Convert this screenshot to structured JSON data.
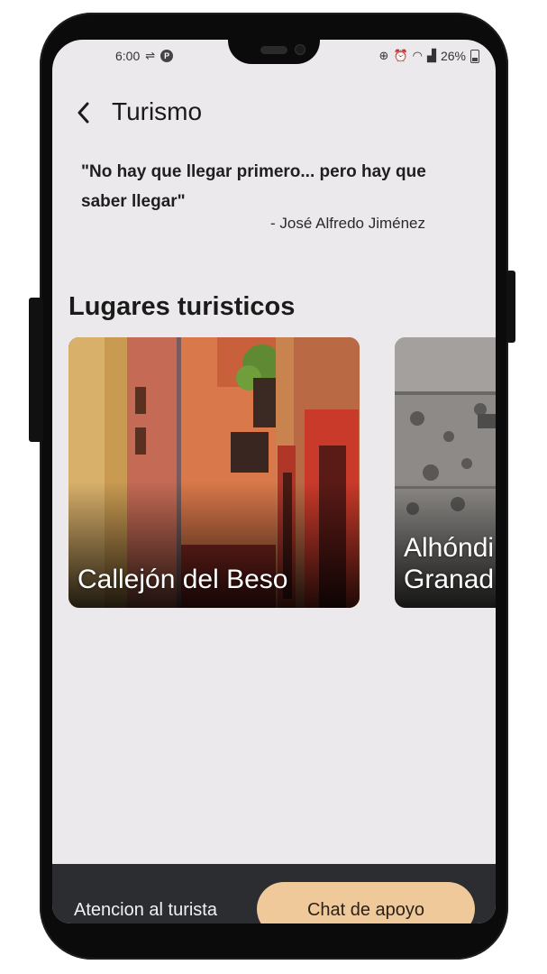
{
  "status_bar": {
    "time": "6:00",
    "battery": "26%",
    "icons": [
      "usb-icon",
      "circle-p-icon",
      "data-saver-icon",
      "alarm-icon",
      "wifi-icon",
      "signal-icon",
      "battery-icon"
    ]
  },
  "app_bar": {
    "title": "Turismo",
    "back_icon": "chevron-left-icon"
  },
  "quote": {
    "text": "\"No hay que llegar primero... pero hay que saber llegar\"",
    "author": "- José Alfredo Jiménez"
  },
  "section": {
    "title": "Lugares turisticos"
  },
  "places": [
    {
      "label": "Callejón del Beso"
    },
    {
      "label": "Alhóndi\nGranad"
    }
  ],
  "bottom_nav": {
    "left_label": "Atencion al turista",
    "right_label": "Chat de apoyo",
    "active_color": "#f0c99a"
  },
  "colors": {
    "background": "#ebe9ec",
    "bottom_bar": "#2c2d30"
  }
}
